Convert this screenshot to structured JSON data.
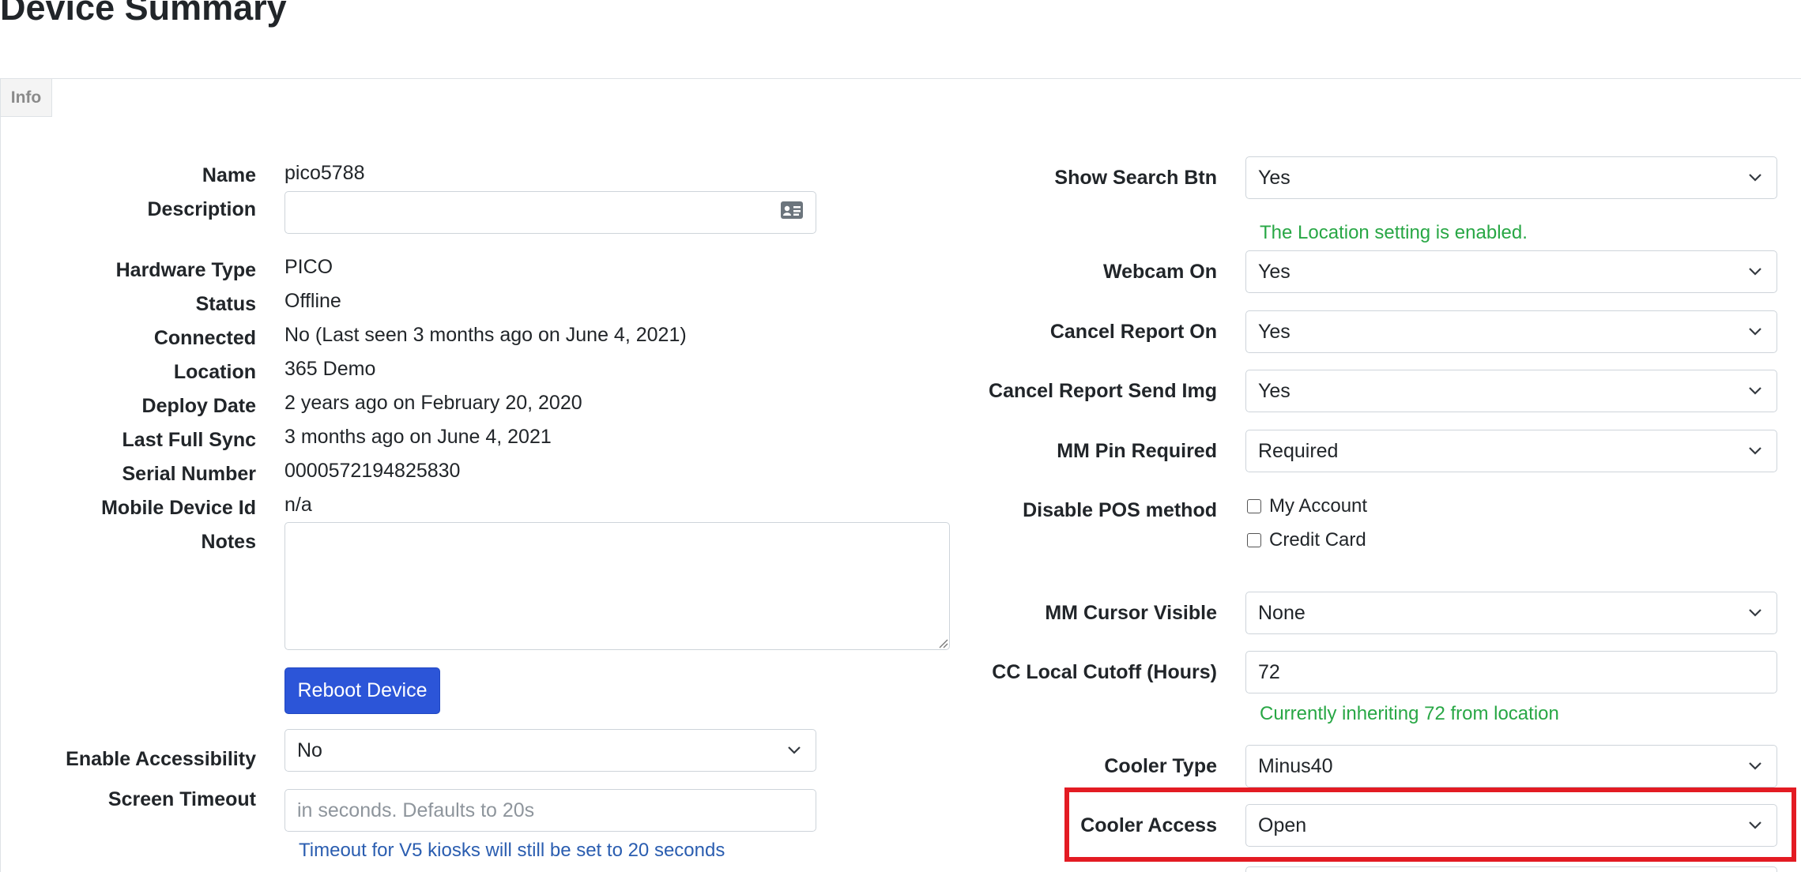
{
  "page": {
    "title": "Device Summary",
    "tab_info": "Info"
  },
  "left": {
    "name_label": "Name",
    "name_value": "pico5788",
    "description_label": "Description",
    "description_value": "",
    "hardware_type_label": "Hardware Type",
    "hardware_type_value": "PICO",
    "status_label": "Status",
    "status_value": "Offline",
    "connected_label": "Connected",
    "connected_value": "No (Last seen 3 months ago on June 4, 2021)",
    "location_label": "Location",
    "location_value": "365 Demo",
    "deploy_date_label": "Deploy Date",
    "deploy_date_value": "2 years ago on February 20, 2020",
    "last_full_sync_label": "Last Full Sync",
    "last_full_sync_value": "3 months ago on June 4, 2021",
    "serial_number_label": "Serial Number",
    "serial_number_value": "0000572194825830",
    "mobile_device_id_label": "Mobile Device Id",
    "mobile_device_id_value": "n/a",
    "notes_label": "Notes",
    "notes_value": "",
    "reboot_button": "Reboot Device",
    "enable_accessibility_label": "Enable Accessibility",
    "enable_accessibility_value": "No",
    "screen_timeout_label": "Screen Timeout",
    "screen_timeout_placeholder": "in seconds. Defaults to 20s",
    "timeout_note": "Timeout for V5 kiosks will still be set to 20 seconds"
  },
  "right": {
    "show_search_btn_label": "Show Search Btn",
    "show_search_btn_value": "Yes",
    "location_note": "The Location setting is enabled.",
    "webcam_on_label": "Webcam On",
    "webcam_on_value": "Yes",
    "cancel_report_on_label": "Cancel Report On",
    "cancel_report_on_value": "Yes",
    "cancel_report_send_img_label": "Cancel Report Send Img",
    "cancel_report_send_img_value": "Yes",
    "mm_pin_required_label": "MM Pin Required",
    "mm_pin_required_value": "Required",
    "disable_pos_method_label": "Disable POS method",
    "pos_options": [
      "My Account",
      "Credit Card"
    ],
    "mm_cursor_visible_label": "MM Cursor Visible",
    "mm_cursor_visible_value": "None",
    "cc_local_cutoff_label": "CC Local Cutoff (Hours)",
    "cc_local_cutoff_value": "72",
    "cutoff_note": "Currently inheriting 72 from location",
    "cooler_type_label": "Cooler Type",
    "cooler_type_value": "Minus40",
    "cooler_access_label": "Cooler Access",
    "cooler_access_value": "Open"
  },
  "colors": {
    "highlight": "#e31b23",
    "accent": "#2c55d8",
    "success_text": "#28a745",
    "info_text": "#2a5db0"
  },
  "icons": {
    "description_field": "contact-card-icon",
    "select": "chevron-down-icon"
  }
}
